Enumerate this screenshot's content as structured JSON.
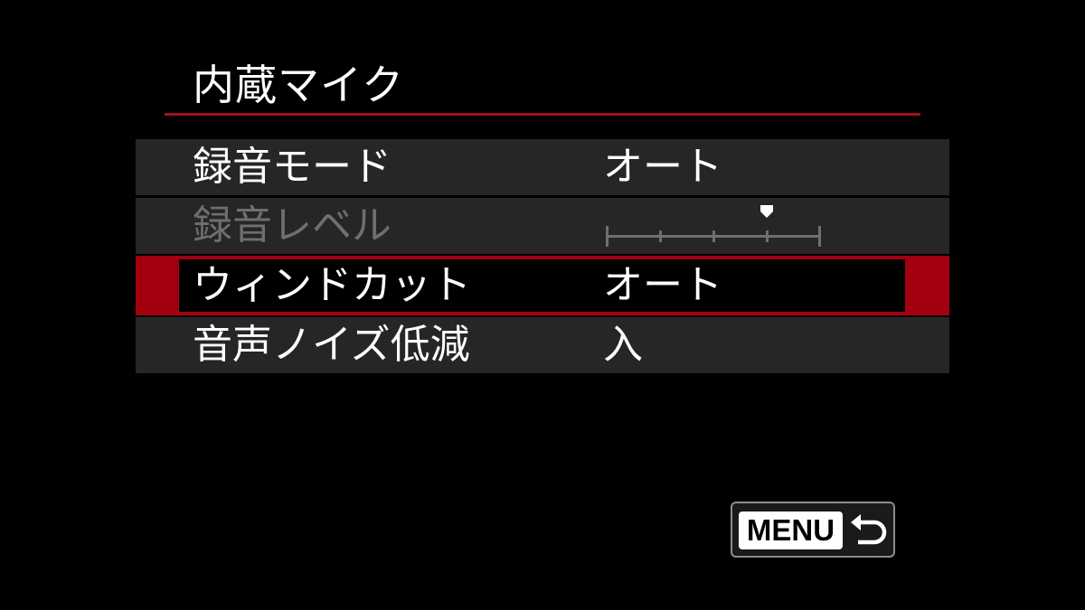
{
  "screen": {
    "title": "内蔵マイク"
  },
  "menu": {
    "items": [
      {
        "label": "録音モード",
        "value": "オート",
        "state": "normal"
      },
      {
        "label": "録音レベル",
        "value": null,
        "state": "disabled",
        "level_meter": {
          "steps": 4,
          "level": 3
        }
      },
      {
        "label": "ウィンドカット",
        "value": "オート",
        "state": "selected"
      },
      {
        "label": "音声ノイズ低減",
        "value": "入",
        "state": "normal"
      }
    ]
  },
  "footer": {
    "menu_button_label": "MENU",
    "return_icon": "return-arrow-icon"
  },
  "colors": {
    "background": "#000000",
    "row_background": "#262626",
    "accent_red": "#a3000f",
    "disabled_text": "#6f6f6f",
    "text": "#ffffff"
  }
}
